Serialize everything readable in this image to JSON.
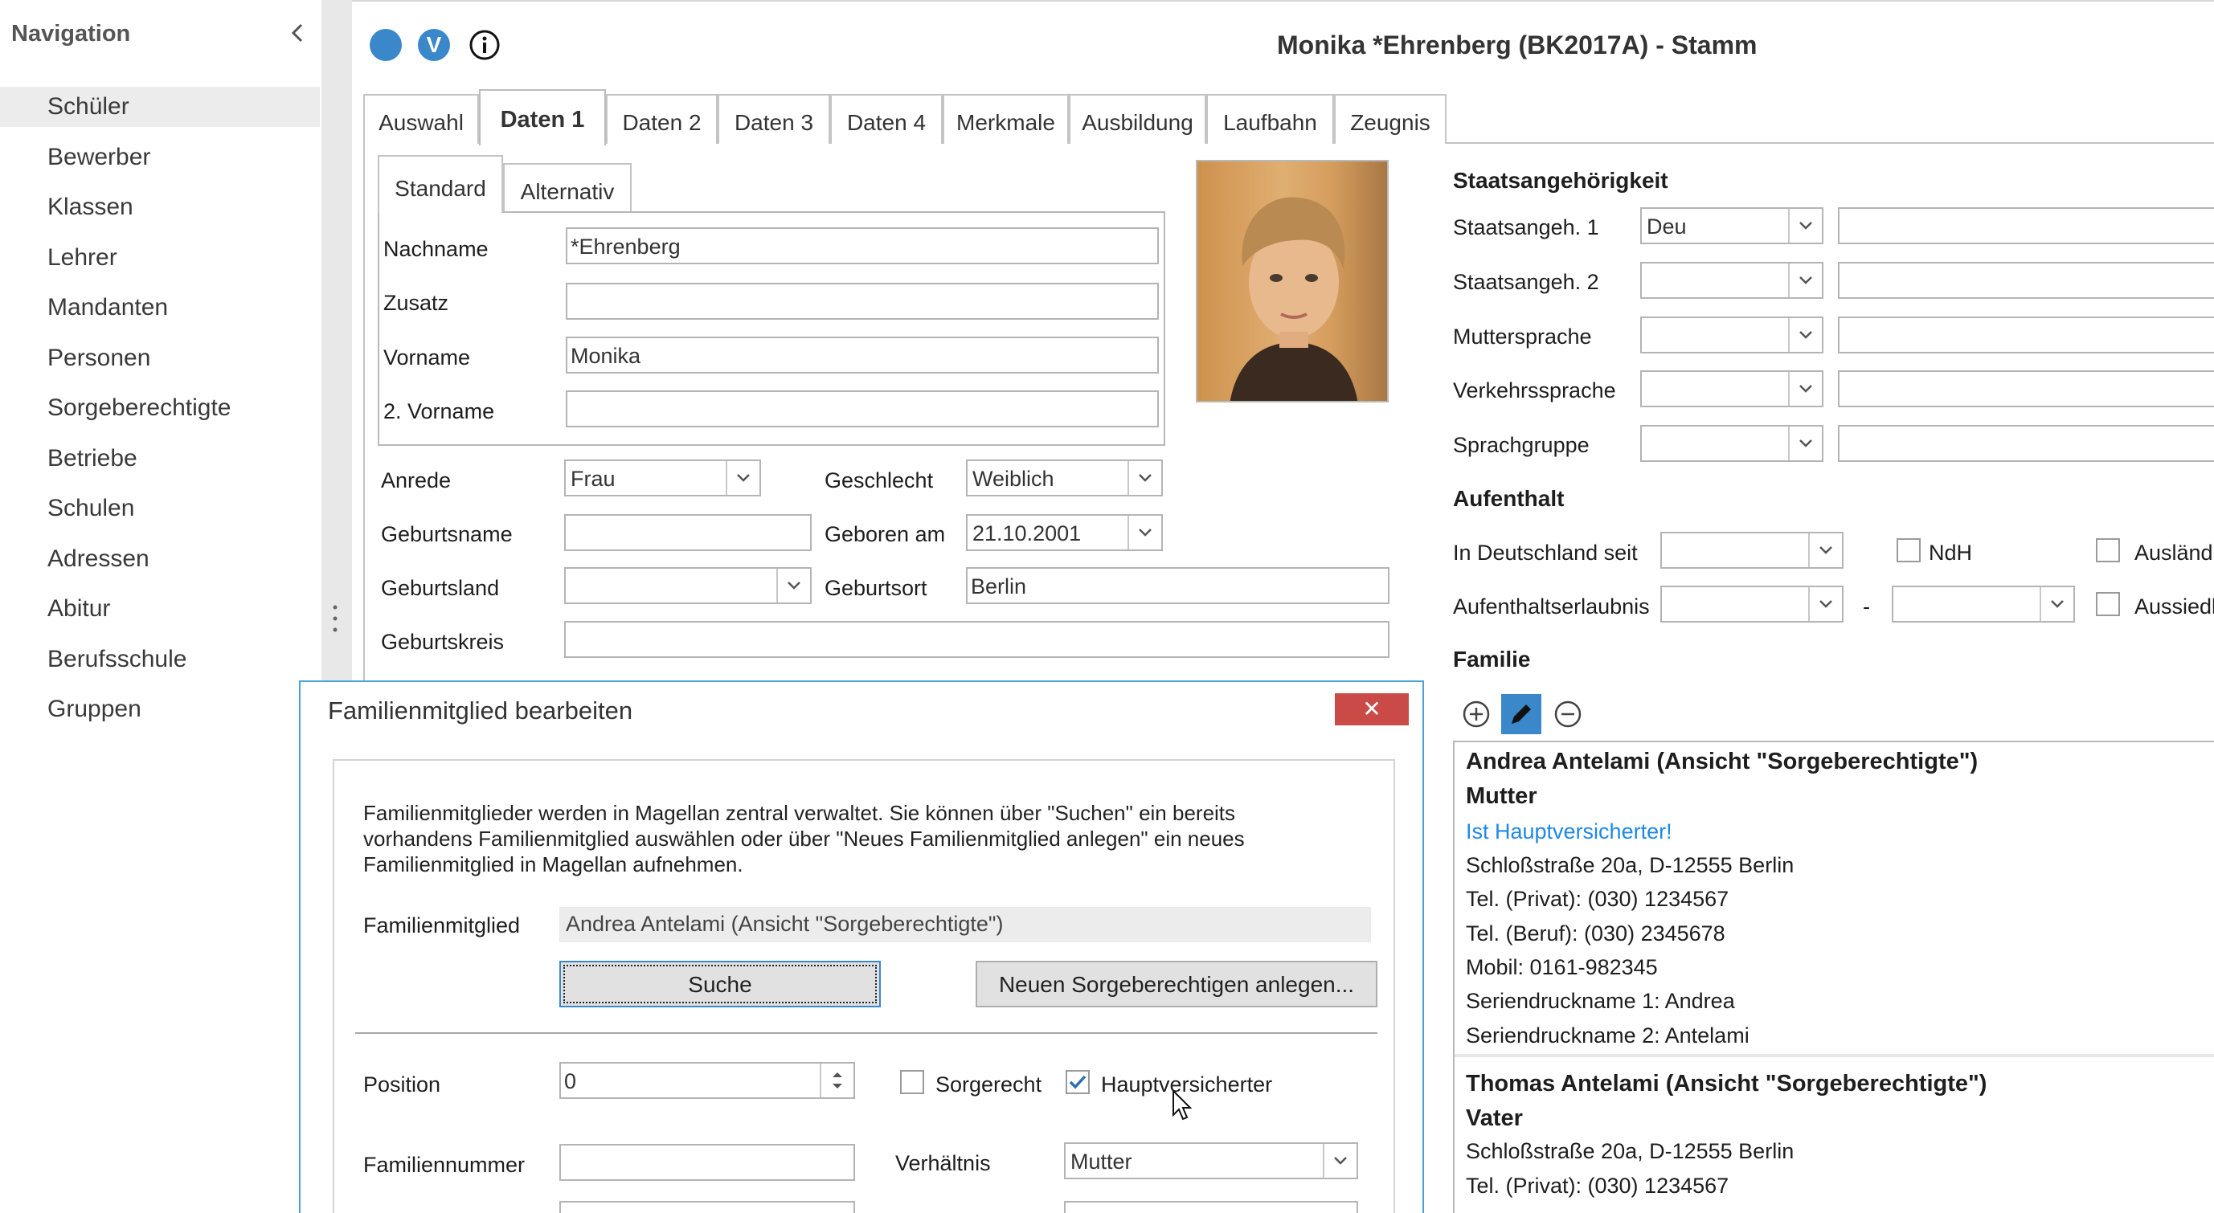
{
  "nav": {
    "title": "Navigation",
    "items": [
      "Schüler",
      "Bewerber",
      "Klassen",
      "Lehrer",
      "Mandanten",
      "Personen",
      "Sorgeberechtigte",
      "Betriebe",
      "Schulen",
      "Adressen",
      "Abitur",
      "Berufsschule",
      "Gruppen"
    ],
    "selected": "Schüler"
  },
  "header": {
    "title": "Monika *Ehrenberg (BK2017A) - Stamm",
    "v_badge": "V"
  },
  "tabs": [
    "Auswahl",
    "Daten 1",
    "Daten 2",
    "Daten 3",
    "Daten 4",
    "Merkmale",
    "Ausbildung",
    "Laufbahn",
    "Zeugnis"
  ],
  "active_tab": "Daten 1",
  "subtabs": [
    "Standard",
    "Alternativ"
  ],
  "name_fields": {
    "nachname": {
      "label": "Nachname",
      "value": "*Ehrenberg"
    },
    "zusatz": {
      "label": "Zusatz",
      "value": ""
    },
    "vorname": {
      "label": "Vorname",
      "value": "Monika"
    },
    "vorname2": {
      "label": "2. Vorname",
      "value": ""
    }
  },
  "person": {
    "anrede": {
      "label": "Anrede",
      "value": "Frau"
    },
    "geschlecht": {
      "label": "Geschlecht",
      "value": "Weiblich"
    },
    "geburtsname": {
      "label": "Geburtsname",
      "value": ""
    },
    "geboren_am": {
      "label": "Geboren am",
      "value": "21.10.2001"
    },
    "geburtsland": {
      "label": "Geburtsland",
      "value": ""
    },
    "geburtsort": {
      "label": "Geburtsort",
      "value": "Berlin"
    },
    "geburtskreis": {
      "label": "Geburtskreis",
      "value": ""
    }
  },
  "staatsangehoerigkeit": {
    "title": "Staatsangehörigkeit",
    "rows": [
      {
        "label": "Staatsangeh. 1",
        "value": "Deu"
      },
      {
        "label": "Staatsangeh. 2",
        "value": ""
      },
      {
        "label": "Muttersprache",
        "value": ""
      },
      {
        "label": "Verkehrssprache",
        "value": ""
      },
      {
        "label": "Sprachgruppe",
        "value": ""
      }
    ]
  },
  "aufenthalt": {
    "title": "Aufenthalt",
    "in_deutschland_seit": "In Deutschland seit",
    "aufenthaltserlaubnis": "Aufenthaltserlaubnis",
    "dash": "-",
    "ndh": "NdH",
    "auslaender": "Ausländ",
    "aussiedler": "Aussiedl"
  },
  "familie": {
    "title": "Familie",
    "members": [
      {
        "name": "Andrea Antelami (Ansicht \"Sorgeberechtigte\")",
        "role": "Mutter",
        "hauptversichert": "Ist Hauptversicherter!",
        "address": "Schloßstraße 20a, D-12555 Berlin",
        "tel_privat": "Tel. (Privat): (030) 1234567",
        "tel_beruf": "Tel. (Beruf): (030) 2345678",
        "mobil": "Mobil: 0161-982345",
        "serien1": "Seriendruckname 1: Andrea",
        "serien2": "Seriendruckname 2: Antelami"
      },
      {
        "name": "Thomas Antelami (Ansicht \"Sorgeberechtigte\")",
        "role": "Vater",
        "address": "Schloßstraße 20a, D-12555 Berlin",
        "tel_privat": "Tel. (Privat): (030) 1234567"
      }
    ]
  },
  "dialog": {
    "title": "Familienmitglied bearbeiten",
    "close": "✕",
    "info_line1": "Familienmitglieder werden in Magellan zentral verwaltet. Sie können über \"Suchen\" ein bereits",
    "info_line2": "vorhandens Familienmitglied auswählen oder über \"Neues Familienmitglied anlegen\" ein neues",
    "info_line3": "Familienmitglied in Magellan aufnehmen.",
    "familienmitglied_label": "Familienmitglied",
    "familienmitglied_value": "Andrea Antelami (Ansicht \"Sorgeberechtigte\")",
    "suche_button": "Suche",
    "neu_button": "Neuen Sorgeberechtigen anlegen...",
    "position_label": "Position",
    "position_value": "0",
    "sorgerecht_label": "Sorgerecht",
    "sorgerecht_checked": false,
    "hauptversicherter_label": "Hauptversicherter",
    "hauptversicherter_checked": true,
    "familiennummer_label": "Familiennummer",
    "familiennummer_value": "",
    "verhaeltnis_label": "Verhältnis",
    "verhaeltnis_value": "Mutter"
  },
  "colors": {
    "accent_blue": "#3a87c9",
    "link_blue": "#1e88e5",
    "close_red": "#c94a46",
    "nav_selected": "#ececec",
    "dialog_border": "#4aa3df"
  }
}
